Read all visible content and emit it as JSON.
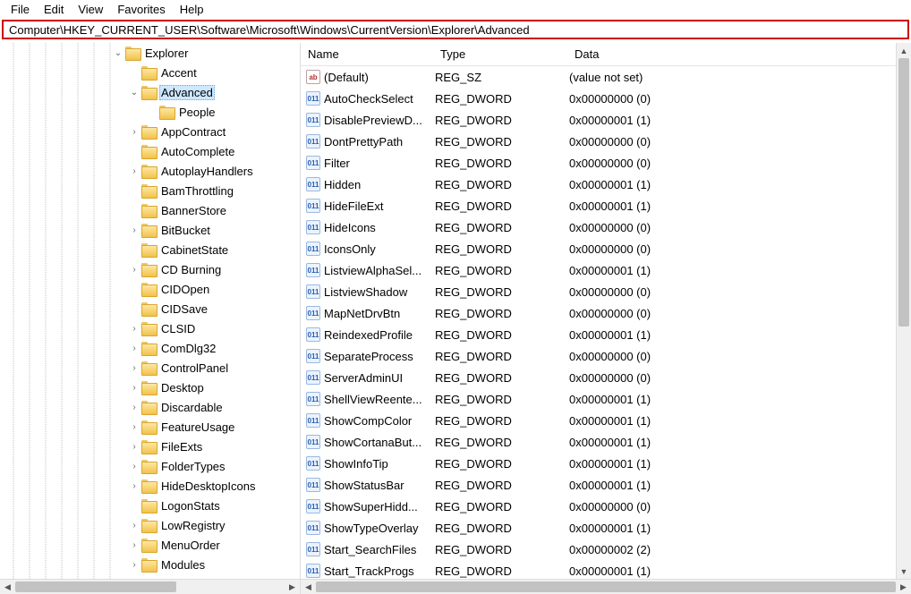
{
  "menu": {
    "items": [
      "File",
      "Edit",
      "View",
      "Favorites",
      "Help"
    ]
  },
  "address": "Computer\\HKEY_CURRENT_USER\\Software\\Microsoft\\Windows\\CurrentVersion\\Explorer\\Advanced",
  "tree": {
    "root_label": "Explorer",
    "children": [
      {
        "label": "Accent",
        "expander": ""
      },
      {
        "label": "Advanced",
        "expander": "v",
        "selected": true,
        "children": [
          {
            "label": "People",
            "expander": ""
          }
        ]
      },
      {
        "label": "AppContract",
        "expander": ">"
      },
      {
        "label": "AutoComplete",
        "expander": ""
      },
      {
        "label": "AutoplayHandlers",
        "expander": ">"
      },
      {
        "label": "BamThrottling",
        "expander": ""
      },
      {
        "label": "BannerStore",
        "expander": ""
      },
      {
        "label": "BitBucket",
        "expander": ">"
      },
      {
        "label": "CabinetState",
        "expander": ""
      },
      {
        "label": "CD Burning",
        "expander": ">"
      },
      {
        "label": "CIDOpen",
        "expander": ""
      },
      {
        "label": "CIDSave",
        "expander": ""
      },
      {
        "label": "CLSID",
        "expander": ">"
      },
      {
        "label": "ComDlg32",
        "expander": ">"
      },
      {
        "label": "ControlPanel",
        "expander": ">"
      },
      {
        "label": "Desktop",
        "expander": ">"
      },
      {
        "label": "Discardable",
        "expander": ">"
      },
      {
        "label": "FeatureUsage",
        "expander": ">"
      },
      {
        "label": "FileExts",
        "expander": ">"
      },
      {
        "label": "FolderTypes",
        "expander": ">"
      },
      {
        "label": "HideDesktopIcons",
        "expander": ">"
      },
      {
        "label": "LogonStats",
        "expander": ""
      },
      {
        "label": "LowRegistry",
        "expander": ">"
      },
      {
        "label": "MenuOrder",
        "expander": ">"
      },
      {
        "label": "Modules",
        "expander": ">"
      }
    ]
  },
  "columns": {
    "name": "Name",
    "type": "Type",
    "data": "Data"
  },
  "values": [
    {
      "icon": "str",
      "name": "(Default)",
      "type": "REG_SZ",
      "data": "(value not set)"
    },
    {
      "icon": "bin",
      "name": "AutoCheckSelect",
      "type": "REG_DWORD",
      "data": "0x00000000 (0)"
    },
    {
      "icon": "bin",
      "name": "DisablePreviewD...",
      "type": "REG_DWORD",
      "data": "0x00000001 (1)"
    },
    {
      "icon": "bin",
      "name": "DontPrettyPath",
      "type": "REG_DWORD",
      "data": "0x00000000 (0)"
    },
    {
      "icon": "bin",
      "name": "Filter",
      "type": "REG_DWORD",
      "data": "0x00000000 (0)"
    },
    {
      "icon": "bin",
      "name": "Hidden",
      "type": "REG_DWORD",
      "data": "0x00000001 (1)"
    },
    {
      "icon": "bin",
      "name": "HideFileExt",
      "type": "REG_DWORD",
      "data": "0x00000001 (1)"
    },
    {
      "icon": "bin",
      "name": "HideIcons",
      "type": "REG_DWORD",
      "data": "0x00000000 (0)"
    },
    {
      "icon": "bin",
      "name": "IconsOnly",
      "type": "REG_DWORD",
      "data": "0x00000000 (0)"
    },
    {
      "icon": "bin",
      "name": "ListviewAlphaSel...",
      "type": "REG_DWORD",
      "data": "0x00000001 (1)"
    },
    {
      "icon": "bin",
      "name": "ListviewShadow",
      "type": "REG_DWORD",
      "data": "0x00000000 (0)"
    },
    {
      "icon": "bin",
      "name": "MapNetDrvBtn",
      "type": "REG_DWORD",
      "data": "0x00000000 (0)"
    },
    {
      "icon": "bin",
      "name": "ReindexedProfile",
      "type": "REG_DWORD",
      "data": "0x00000001 (1)"
    },
    {
      "icon": "bin",
      "name": "SeparateProcess",
      "type": "REG_DWORD",
      "data": "0x00000000 (0)"
    },
    {
      "icon": "bin",
      "name": "ServerAdminUI",
      "type": "REG_DWORD",
      "data": "0x00000000 (0)"
    },
    {
      "icon": "bin",
      "name": "ShellViewReente...",
      "type": "REG_DWORD",
      "data": "0x00000001 (1)"
    },
    {
      "icon": "bin",
      "name": "ShowCompColor",
      "type": "REG_DWORD",
      "data": "0x00000001 (1)"
    },
    {
      "icon": "bin",
      "name": "ShowCortanaBut...",
      "type": "REG_DWORD",
      "data": "0x00000001 (1)"
    },
    {
      "icon": "bin",
      "name": "ShowInfoTip",
      "type": "REG_DWORD",
      "data": "0x00000001 (1)"
    },
    {
      "icon": "bin",
      "name": "ShowStatusBar",
      "type": "REG_DWORD",
      "data": "0x00000001 (1)"
    },
    {
      "icon": "bin",
      "name": "ShowSuperHidd...",
      "type": "REG_DWORD",
      "data": "0x00000000 (0)"
    },
    {
      "icon": "bin",
      "name": "ShowTypeOverlay",
      "type": "REG_DWORD",
      "data": "0x00000001 (1)"
    },
    {
      "icon": "bin",
      "name": "Start_SearchFiles",
      "type": "REG_DWORD",
      "data": "0x00000002 (2)"
    },
    {
      "icon": "bin",
      "name": "Start_TrackProgs",
      "type": "REG_DWORD",
      "data": "0x00000001 (1)"
    }
  ]
}
